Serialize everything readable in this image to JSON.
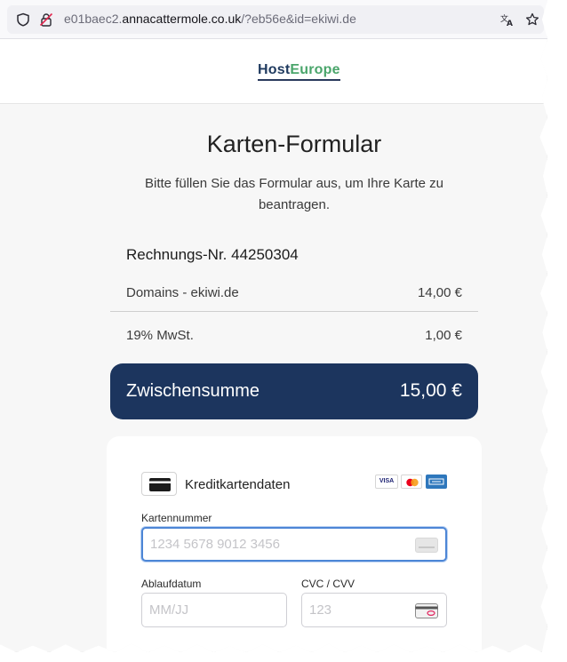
{
  "browser": {
    "url_prefix": "e01baec2.",
    "url_host": "annacattermole.co.uk",
    "url_path": "/?eb56e&id=ekiwi.de"
  },
  "header": {
    "logo_part1": "Host",
    "logo_part2": "Europe"
  },
  "page": {
    "title": "Karten-Formular",
    "subtitle": "Bitte füllen Sie das Formular aus, um Ihre Karte zu beantragen."
  },
  "invoice": {
    "number_label": "Rechnungs-Nr. 44250304",
    "items": [
      {
        "label": "Domains - ekiwi.de",
        "amount": "14,00 €"
      },
      {
        "label": "19% MwSt.",
        "amount": "1,00 €"
      }
    ],
    "subtotal_label": "Zwischensumme",
    "subtotal_amount": "15,00 €"
  },
  "card_form": {
    "heading": "Kreditkartendaten",
    "brands": [
      "VISA",
      "Mastercard",
      "AMEX"
    ],
    "card_number": {
      "label": "Kartennummer",
      "placeholder": "1234 5678 9012 3456",
      "value": ""
    },
    "expiry": {
      "label": "Ablaufdatum",
      "placeholder": "MM/JJ",
      "value": ""
    },
    "cvc": {
      "label": "CVC / CVV",
      "placeholder": "123",
      "value": ""
    }
  },
  "colors": {
    "primary_navy": "#1c355e",
    "logo_green": "#4aa56b",
    "focus_blue": "#4d86d6"
  }
}
